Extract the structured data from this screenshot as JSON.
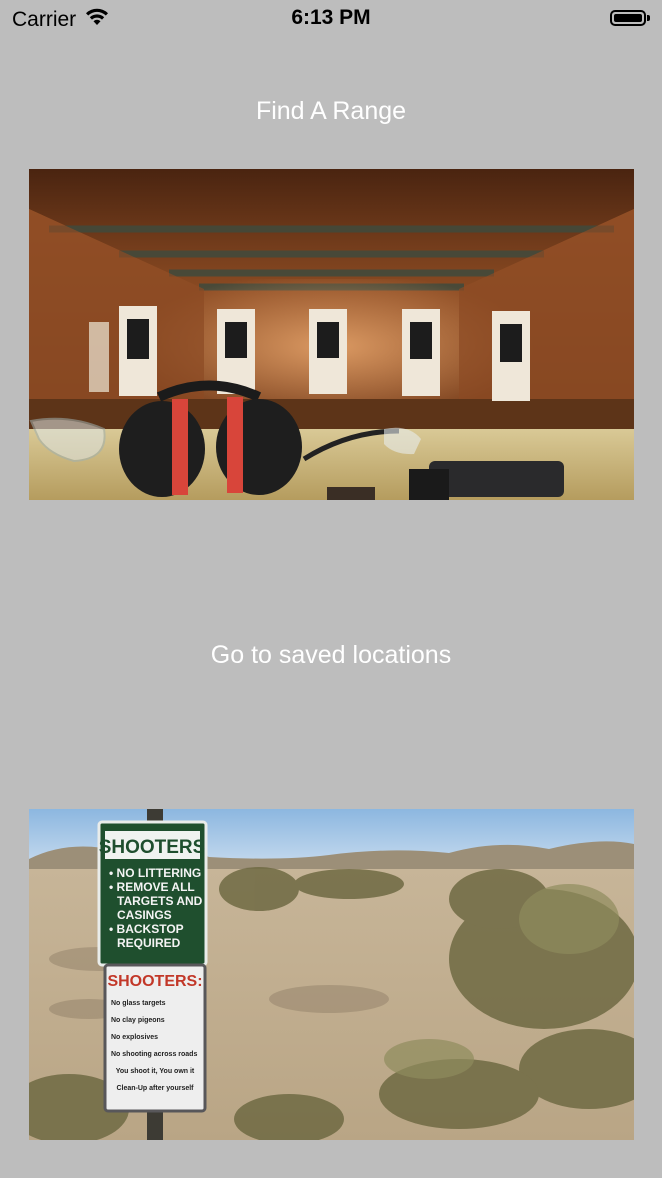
{
  "status_bar": {
    "carrier": "Carrier",
    "time": "6:13 PM",
    "wifi_icon": "wifi-icon",
    "battery_icon": "battery-full-icon",
    "battery_level": 1.0
  },
  "menu": {
    "find_range_label": "Find A Range",
    "saved_locations_label": "Go to saved locations"
  },
  "images": {
    "indoor_range": {
      "subject": "indoor shooting range with ear protection, glasses and pistol"
    },
    "outdoor_range": {
      "sign_top_title": "SHOOTERS",
      "sign_top_rules": [
        "• NO LITTERING",
        "• REMOVE ALL",
        "TARGETS AND",
        "CASINGS",
        "• BACKSTOP",
        "REQUIRED"
      ],
      "sign_bottom_title": "SHOOTERS:",
      "sign_bottom_rules": [
        "No glass targets",
        "No clay pigeons",
        "No explosives",
        "No shooting across roads",
        "You shoot it, You own it",
        "Clean-Up after yourself"
      ]
    }
  },
  "colors": {
    "background": "#bdbdbd",
    "link_text": "#ffffff"
  }
}
